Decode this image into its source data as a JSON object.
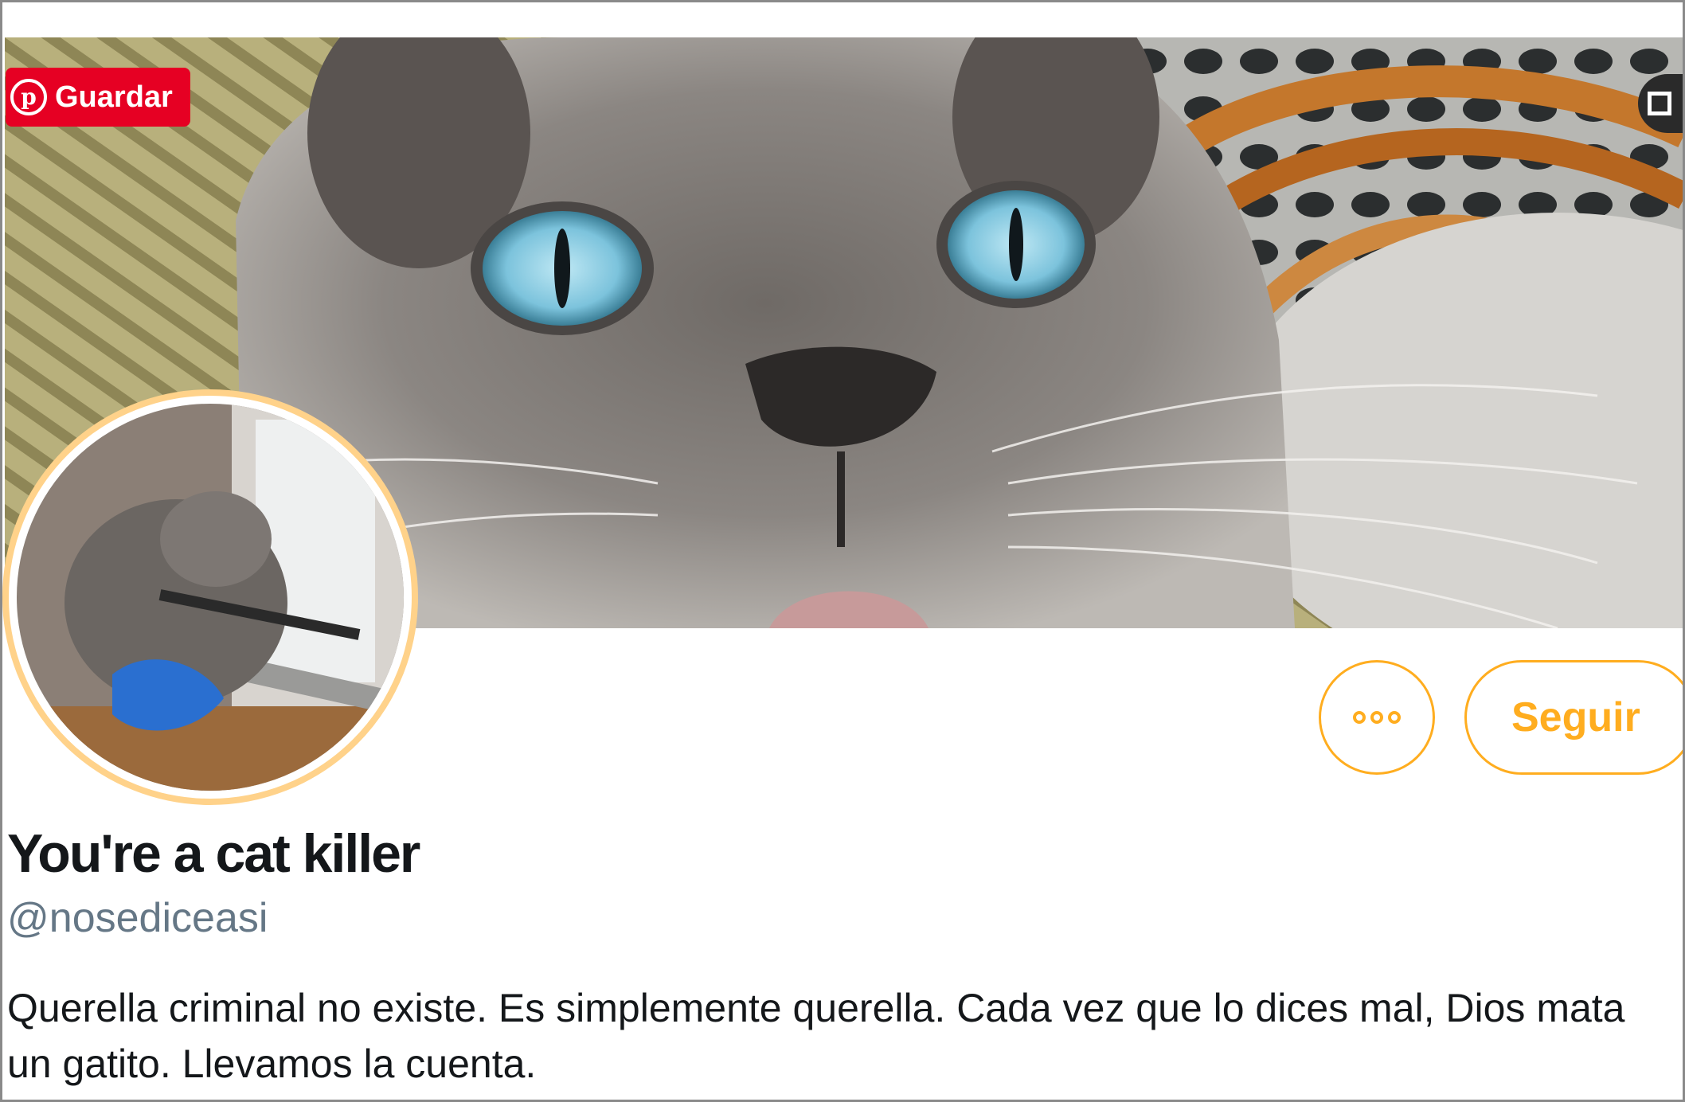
{
  "pin_save": {
    "label": "Guardar",
    "icon": "pinterest-icon",
    "color": "#e60023"
  },
  "banner": {
    "icon": "expand-icon"
  },
  "actions": {
    "more_icon": "more-dots-icon",
    "follow_label": "Seguir",
    "accent": "#ffad1f"
  },
  "profile": {
    "display_name": "You're a cat killer",
    "handle": "@nosediceasi",
    "bio": "Querella criminal no existe. Es simplemente querella. Cada vez que lo dices mal, Dios mata un gatito. Llevamos la cuenta."
  }
}
